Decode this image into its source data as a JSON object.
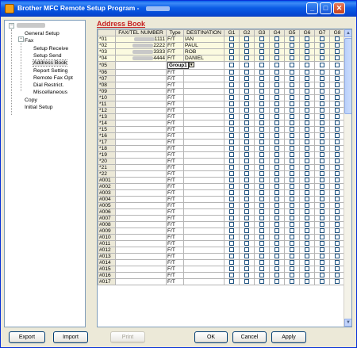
{
  "window": {
    "title": "Brother MFC Remote Setup Program - "
  },
  "tree": {
    "root": "",
    "items": [
      {
        "label": "General Setup",
        "level": 1
      },
      {
        "label": "Fax",
        "level": 1
      },
      {
        "label": "Setup Receive",
        "level": 2
      },
      {
        "label": "Setup Send",
        "level": 2
      },
      {
        "label": "Address Book",
        "level": 2,
        "selected": true
      },
      {
        "label": "Report Setting",
        "level": 2
      },
      {
        "label": "Remote Fax Opt",
        "level": 2
      },
      {
        "label": "Dial Restrict.",
        "level": 2
      },
      {
        "label": "Miscellaneous",
        "level": 2
      },
      {
        "label": "Copy",
        "level": 1
      },
      {
        "label": "Initial Setup",
        "level": 1
      }
    ]
  },
  "main": {
    "heading": "Address Book"
  },
  "table": {
    "headers": [
      "",
      "FAX/TEL NUMBER",
      "Type",
      "DESTINATION",
      "G1",
      "G2",
      "G3",
      "G4",
      "G5",
      "G6",
      "G7",
      "G8"
    ],
    "rows": [
      {
        "no": "*01",
        "number": "1111",
        "type": "F/T",
        "dest": "IAN"
      },
      {
        "no": "*02",
        "number": "2222",
        "type": "F/T",
        "dest": "PAUL"
      },
      {
        "no": "*03",
        "number": "3333",
        "type": "F/T",
        "dest": "ROB"
      },
      {
        "no": "*04",
        "number": "4444",
        "type": "F/T",
        "dest": "DANIEL"
      },
      {
        "no": "*05",
        "number": "",
        "type": "Group1",
        "dest": "",
        "dropdown": true
      },
      {
        "no": "*06",
        "number": "",
        "type": "F/T",
        "dest": ""
      },
      {
        "no": "*07",
        "number": "",
        "type": "F/T",
        "dest": ""
      },
      {
        "no": "*08",
        "number": "",
        "type": "F/T",
        "dest": ""
      },
      {
        "no": "*09",
        "number": "",
        "type": "F/T",
        "dest": ""
      },
      {
        "no": "*10",
        "number": "",
        "type": "F/T",
        "dest": ""
      },
      {
        "no": "*11",
        "number": "",
        "type": "F/T",
        "dest": ""
      },
      {
        "no": "*12",
        "number": "",
        "type": "F/T",
        "dest": ""
      },
      {
        "no": "*13",
        "number": "",
        "type": "F/T",
        "dest": ""
      },
      {
        "no": "*14",
        "number": "",
        "type": "F/T",
        "dest": ""
      },
      {
        "no": "*15",
        "number": "",
        "type": "F/T",
        "dest": ""
      },
      {
        "no": "*16",
        "number": "",
        "type": "F/T",
        "dest": ""
      },
      {
        "no": "*17",
        "number": "",
        "type": "F/T",
        "dest": ""
      },
      {
        "no": "*18",
        "number": "",
        "type": "F/T",
        "dest": ""
      },
      {
        "no": "*19",
        "number": "",
        "type": "F/T",
        "dest": ""
      },
      {
        "no": "*20",
        "number": "",
        "type": "F/T",
        "dest": ""
      },
      {
        "no": "*21",
        "number": "",
        "type": "F/T",
        "dest": ""
      },
      {
        "no": "*22",
        "number": "",
        "type": "F/T",
        "dest": ""
      },
      {
        "no": "#001",
        "number": "",
        "type": "F/T",
        "dest": ""
      },
      {
        "no": "#002",
        "number": "",
        "type": "F/T",
        "dest": ""
      },
      {
        "no": "#003",
        "number": "",
        "type": "F/T",
        "dest": ""
      },
      {
        "no": "#004",
        "number": "",
        "type": "F/T",
        "dest": ""
      },
      {
        "no": "#005",
        "number": "",
        "type": "F/T",
        "dest": ""
      },
      {
        "no": "#006",
        "number": "",
        "type": "F/T",
        "dest": ""
      },
      {
        "no": "#007",
        "number": "",
        "type": "F/T",
        "dest": ""
      },
      {
        "no": "#008",
        "number": "",
        "type": "F/T",
        "dest": ""
      },
      {
        "no": "#009",
        "number": "",
        "type": "F/T",
        "dest": ""
      },
      {
        "no": "#010",
        "number": "",
        "type": "F/T",
        "dest": ""
      },
      {
        "no": "#011",
        "number": "",
        "type": "F/T",
        "dest": ""
      },
      {
        "no": "#012",
        "number": "",
        "type": "F/T",
        "dest": ""
      },
      {
        "no": "#013",
        "number": "",
        "type": "F/T",
        "dest": ""
      },
      {
        "no": "#014",
        "number": "",
        "type": "F/T",
        "dest": ""
      },
      {
        "no": "#015",
        "number": "",
        "type": "F/T",
        "dest": ""
      },
      {
        "no": "#016",
        "number": "",
        "type": "F/T",
        "dest": ""
      },
      {
        "no": "#017",
        "number": "",
        "type": "F/T",
        "dest": ""
      }
    ]
  },
  "buttons": {
    "export": "Export",
    "import": "Import",
    "print": "Print",
    "ok": "OK",
    "cancel": "Cancel",
    "apply": "Apply"
  },
  "titlebar_buttons": {
    "minimize": "_",
    "maximize": "□",
    "close": "✕"
  },
  "scroll": {
    "up": "▲",
    "down": "▼"
  },
  "colors": {
    "heading": "#c62020",
    "titlebar": "#0548d4",
    "filled_row": "#fbfae0"
  }
}
